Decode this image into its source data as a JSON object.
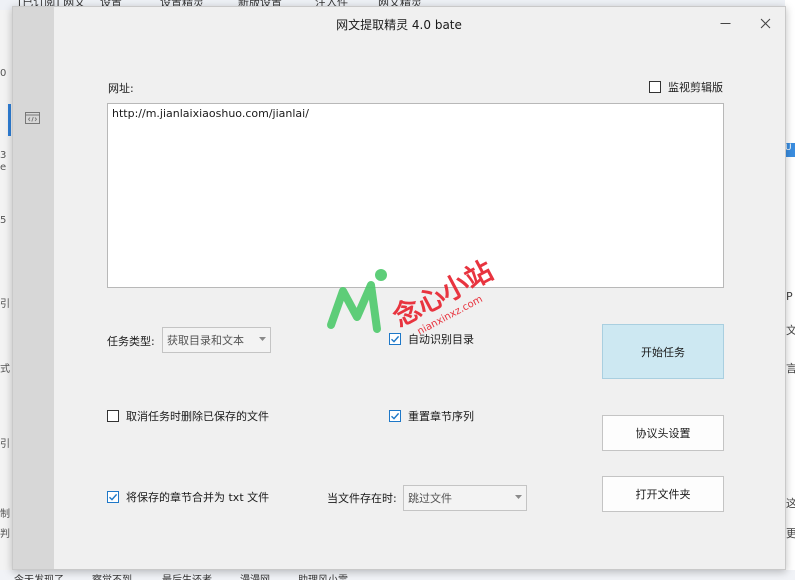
{
  "window": {
    "title": "网文提取精灵 4.0 bate"
  },
  "url": {
    "label": "网址:",
    "value": "http://m.jianlaixiaoshuo.com/jianlai/"
  },
  "monitor_clipboard": {
    "label": "监视剪辑版",
    "checked": false
  },
  "task_type": {
    "label": "任务类型:",
    "selected": "获取目录和文本"
  },
  "auto_detect_toc": {
    "label": "自动识别目录",
    "checked": true
  },
  "delete_on_cancel": {
    "label": "取消任务时删除已保存的文件",
    "checked": false
  },
  "reset_chapter_order": {
    "label": "重置章节序列",
    "checked": true
  },
  "merge_txt": {
    "label": "将保存的章节合并为 txt 文件",
    "checked": true
  },
  "file_exists": {
    "label": "当文件存在时:",
    "selected": "跳过文件"
  },
  "buttons": {
    "start": "开始任务",
    "headers": "协议头设置",
    "open_folder": "打开文件夹"
  },
  "watermark": {
    "text": "念心小站",
    "domain": "nianxinxz.com",
    "color": "#e8343f",
    "logo_color": "#4cc96a"
  },
  "icons": {
    "sidebar": "code-icon",
    "minimize": "minimize-icon",
    "close": "close-icon",
    "checkbox_checked": "checkmark-icon",
    "combo_arrow": "chevron-down-icon"
  },
  "colors": {
    "start_button": "#cde8f2",
    "checkbox_accent": "#1e78c8",
    "window_bg": "#f0f0f0"
  },
  "background": {
    "top_texts": [
      "[已订阅] 网文",
      "设置",
      "设置精灵",
      "新版设置",
      "注入件",
      "网文精灵"
    ],
    "left_texts": [
      "0",
      "3",
      "e",
      "5",
      "引",
      "式",
      "引",
      "制",
      "判"
    ],
    "right_texts": [
      "U",
      "P",
      "文",
      "言",
      "这",
      "更"
    ],
    "bottom_texts": [
      "今天发现了",
      "察觉不到",
      "最后生还者",
      "漫漫网",
      "助理风小雪"
    ]
  }
}
